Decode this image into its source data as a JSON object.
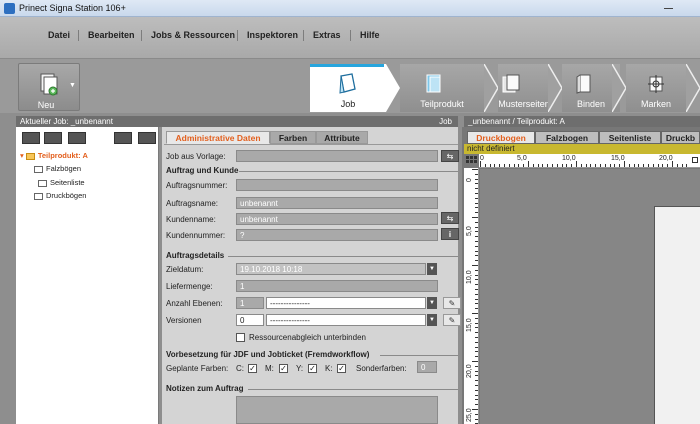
{
  "window": {
    "title": "Prinect Signa Station 106+"
  },
  "menu": [
    "Datei",
    "Bearbeiten",
    "Jobs & Ressourcen",
    "Inspektoren",
    "Extras",
    "Hilfe"
  ],
  "toolbar": {
    "new_label": "Neu",
    "steps": [
      "Job",
      "Teilprodukt",
      "Musterseiten",
      "Binden",
      "Marken"
    ],
    "active_step": "Job"
  },
  "left_panel": {
    "header": "Aktueller Job: _unbenannt",
    "header_right": "Job",
    "tree": {
      "root": "Teilprodukt: A",
      "children": [
        "Falzbögen",
        "Seitenliste",
        "Druckbögen"
      ]
    }
  },
  "form": {
    "tabs": [
      "Administrative Daten",
      "Farben",
      "Attribute"
    ],
    "active_tab": "Administrative Daten",
    "job_from_template_label": "Job aus Vorlage:",
    "section_order": "Auftrag und Kunde",
    "order_number_label": "Auftragsnummer:",
    "order_number_value": "",
    "order_name_label": "Auftragsname:",
    "order_name_value": "unbenannt",
    "customer_name_label": "Kundenname:",
    "customer_name_value": "unbenannt",
    "customer_number_label": "Kundennummer:",
    "customer_number_value": "?",
    "section_details": "Auftragsdetails",
    "due_date_label": "Zieldatum:",
    "due_date_value": "19.10.2018 10:18",
    "quantity_label": "Liefermenge:",
    "quantity_value": "1",
    "levels_label": "Anzahl Ebenen:",
    "levels_value": "1",
    "levels_select": "---------------",
    "versions_label": "Versionen",
    "versions_value": "0",
    "versions_select": "---------------",
    "resource_sync_label": "Ressourcenabgleich unterbinden",
    "section_jdf": "Vorbesetzung für JDF und Jobticket (Fremdworkflow)",
    "planned_colors_label": "Geplante Farben:",
    "colors": [
      "C:",
      "M:",
      "Y:",
      "K:"
    ],
    "spot_colors_label": "Sonderfarben:",
    "spot_colors_value": "0",
    "section_notes": "Notizen zum Auftrag"
  },
  "right_panel": {
    "header": "_unbenannt / Teilprodukt: A",
    "tabs": [
      "Druckbogen",
      "Falzbogen",
      "Seitenliste",
      "Druckb"
    ],
    "active_tab": "Druckbogen",
    "status": "nicht definiert",
    "ruler_top": [
      "0",
      "5,0",
      "10,0",
      "15,0",
      "20,0"
    ],
    "ruler_left": [
      "0",
      "5,0",
      "10,0",
      "15,0",
      "20,0",
      "25,0"
    ]
  },
  "colors": {
    "accent": "#e35f1d",
    "active_step_bar": "#27a5dd",
    "status_strip": "#c8b830"
  }
}
